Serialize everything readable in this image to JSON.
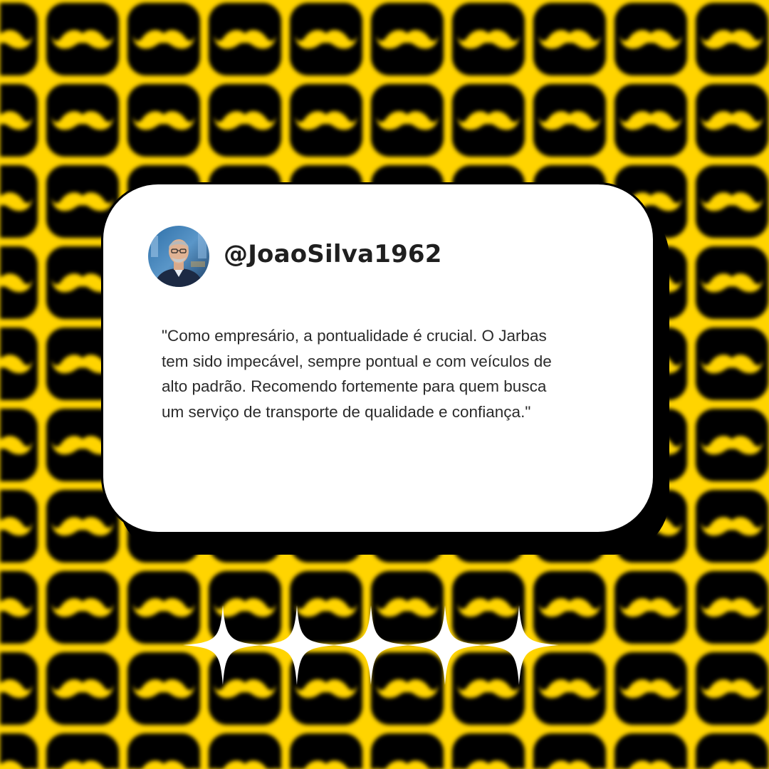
{
  "background": {
    "color": "#ffd400",
    "pattern_icon": "mustache-icon",
    "tile_color": "#000000"
  },
  "testimonial": {
    "avatar_icon": "profile-photo",
    "handle": "@JoaoSilva1962",
    "quote": " \"Como empresário, a pontualidade é crucial. O Jarbas\ntem sido impecável, sempre pontual e com veículos de\nalto padrão. Recomendo fortemente para quem busca\num serviço de transporte de qualidade e confiança.\"",
    "card_color": "#ffffff",
    "shadow_color": "#000000"
  },
  "rating": {
    "stars": 5,
    "icon": "sparkle-star-icon",
    "color": "#ffffff"
  }
}
